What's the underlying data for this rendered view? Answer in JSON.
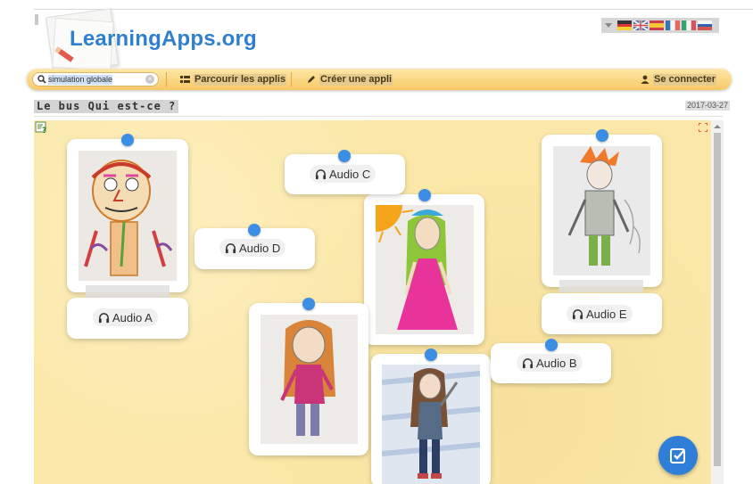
{
  "header": {
    "logo_text": "LearningApps.org",
    "languages": [
      "de",
      "en",
      "es",
      "fr",
      "it",
      "ru"
    ]
  },
  "nav": {
    "search_value": "simulation globale",
    "browse_label": "Parcourir les applis",
    "create_label": "Créer une appli",
    "login_label": "Se connecter"
  },
  "app": {
    "title": "Le bus Qui est-ce ?",
    "date": "2017-03-27"
  },
  "audio": {
    "a": "Audio A",
    "b": "Audio B",
    "c": "Audio C",
    "d": "Audio D",
    "e": "Audio E"
  },
  "colors": {
    "accent": "#3b8ee3",
    "navbar": "#f8c965",
    "canvas": "#fbe8a8",
    "logo": "#2f7fd0"
  }
}
